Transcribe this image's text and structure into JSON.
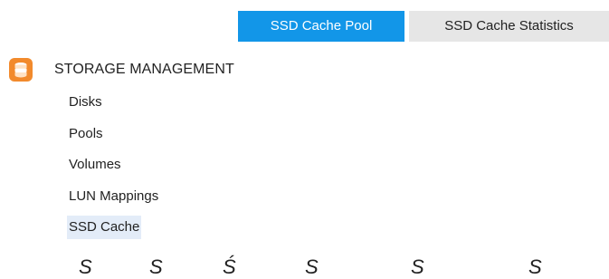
{
  "tabs": {
    "active_label": "SSD Cache Pool",
    "inactive_label": "SSD Cache Statistics"
  },
  "section": {
    "title": "STORAGE MANAGEMENT",
    "icon": "storage-database-icon"
  },
  "nav": {
    "items": [
      {
        "label": "Disks"
      },
      {
        "label": "Pools"
      },
      {
        "label": "Volumes"
      },
      {
        "label": "LUN Mappings"
      },
      {
        "label": "SSD Cache"
      }
    ],
    "selected": "SSD Cache"
  },
  "table_header_letters": [
    "S",
    "S",
    "Ś",
    "S",
    "S",
    "S"
  ],
  "colors": {
    "accent": "#1296e8",
    "tab_inactive": "#e6e6e6",
    "icon_orange": "#f28a2c",
    "selected_bg": "#e3ecf8"
  }
}
